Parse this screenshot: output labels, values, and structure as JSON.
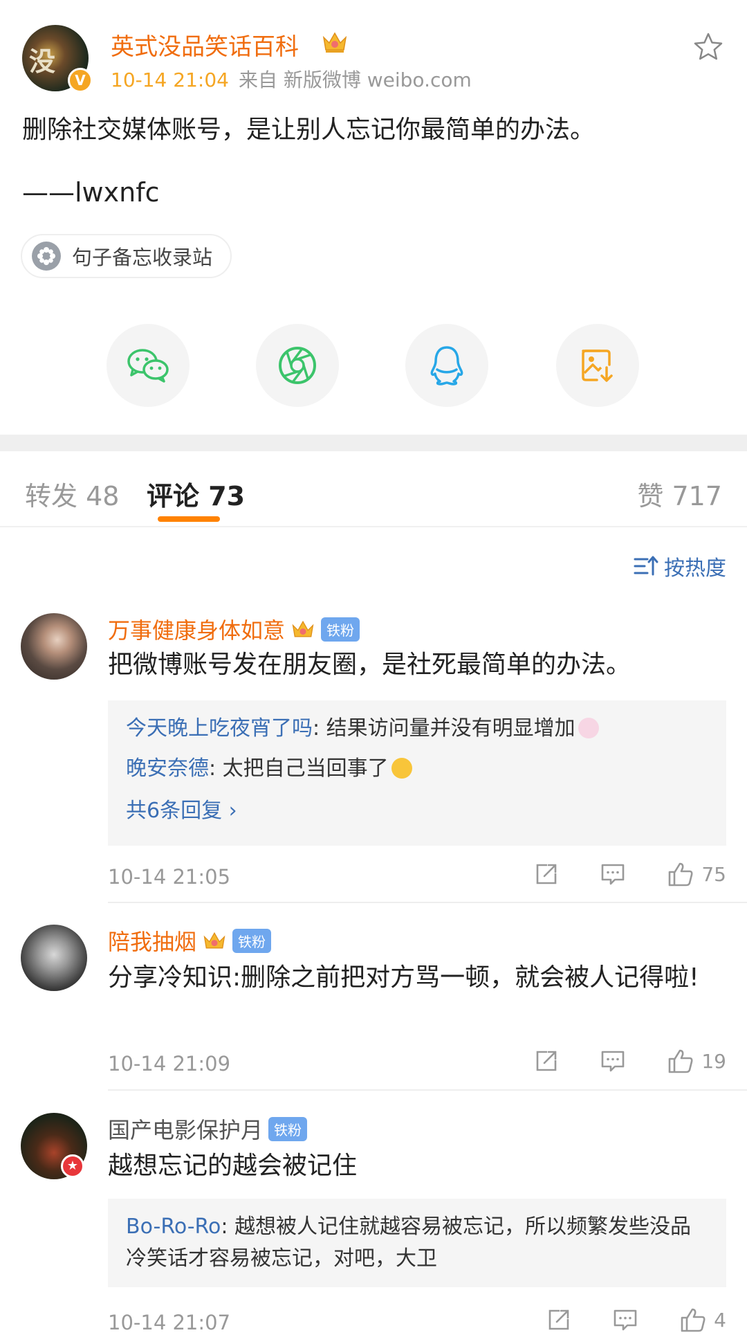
{
  "post": {
    "author": "英式没品笑话百科",
    "avatar_glyph": "没",
    "verified_mark": "V",
    "time": "10-14 21:04",
    "source": "来自 新版微博 weibo.com",
    "text": "删除社交媒体账号，是让别人忘记你最简单的办法。",
    "signature": "——lwxnfc",
    "topic_chip": "句子备忘收录站"
  },
  "share_targets": [
    "wechat-icon",
    "moments-icon",
    "qq-icon",
    "save-image-icon"
  ],
  "tabs": {
    "repost": "转发 48",
    "comment": "评论 73",
    "like": "赞 717"
  },
  "sort": {
    "label": "按热度"
  },
  "colors": {
    "accent": "#ff8200",
    "name_orange": "#f06d0f",
    "link_blue": "#3b6fb5",
    "badge_blue": "#6fa7ee"
  },
  "comments": [
    {
      "user": "万事健康身体如意",
      "badge": "铁粉",
      "text": "把微博账号发在朋友圈，是社死最简单的办法。",
      "replies": [
        {
          "user": "今天晚上吃夜宵了吗",
          "sep": ": ",
          "text": "结果访问量并没有明显增加"
        },
        {
          "user": "晚安奈德",
          "sep": ": ",
          "text": "太把自己当回事了"
        }
      ],
      "more_replies": "共6条回复 ›",
      "time": "10-14 21:05",
      "likes": "75"
    },
    {
      "user": "陪我抽烟",
      "badge": "铁粉",
      "text": "分享冷知识:删除之前把对方骂一顿，就会被人记得啦!",
      "time": "10-14 21:09",
      "likes": "19"
    },
    {
      "user": "国产电影保护月",
      "badge": "铁粉",
      "text": "越想忘记的越会被记住",
      "replies": [
        {
          "user": "Bo-Ro-Ro",
          "sep": ": ",
          "text": "越想被人记住就越容易被忘记，所以频繁发些没品冷笑话才容易被忘记，对吧，大卫"
        }
      ],
      "time": "10-14 21:07",
      "likes": "4"
    }
  ]
}
